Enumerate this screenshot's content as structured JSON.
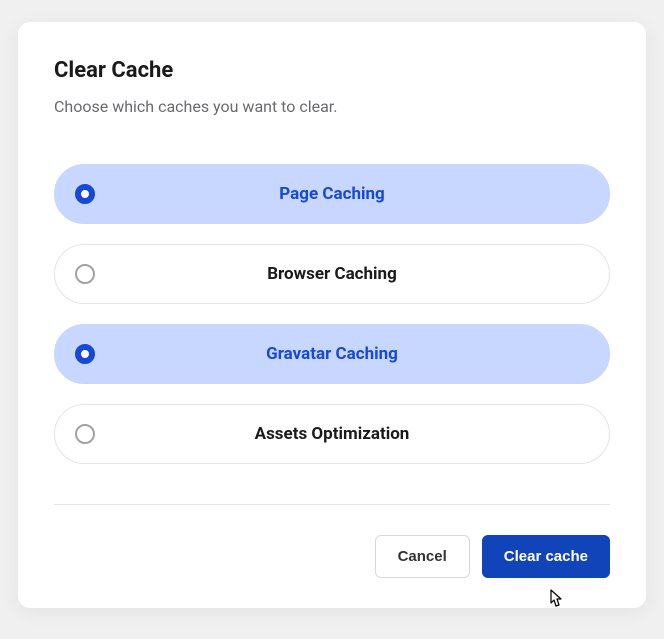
{
  "modal": {
    "title": "Clear Cache",
    "subtitle": "Choose which caches you want to clear.",
    "options": [
      {
        "label": "Page Caching",
        "selected": true
      },
      {
        "label": "Browser Caching",
        "selected": false
      },
      {
        "label": "Gravatar Caching",
        "selected": true
      },
      {
        "label": "Assets Optimization",
        "selected": false
      }
    ],
    "actions": {
      "cancel": "Cancel",
      "confirm": "Clear cache"
    }
  }
}
